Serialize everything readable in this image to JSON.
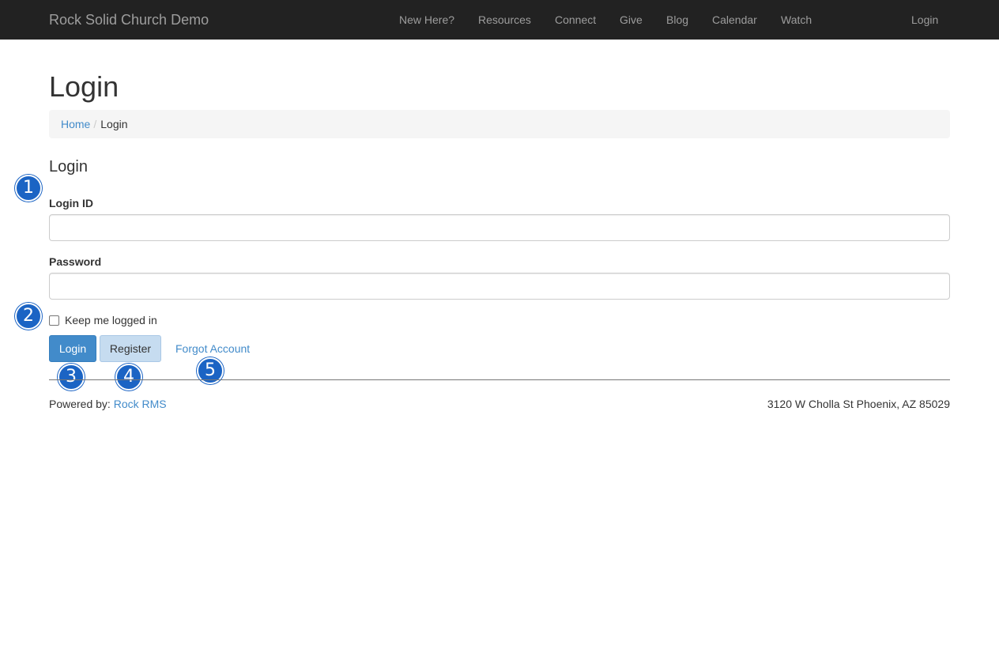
{
  "navbar": {
    "brand": "Rock Solid Church Demo",
    "items": [
      "New Here?",
      "Resources",
      "Connect",
      "Give",
      "Blog",
      "Calendar",
      "Watch"
    ],
    "login": "Login",
    "background": "#222222"
  },
  "page": {
    "title": "Login"
  },
  "breadcrumb": {
    "home": "Home",
    "separator": "/",
    "current": "Login"
  },
  "form": {
    "heading": "Login",
    "login_id_label": "Login ID",
    "login_id_value": "",
    "password_label": "Password",
    "password_value": "",
    "keep_logged_in_label": "Keep me logged in",
    "keep_logged_in_checked": false,
    "login_button": "Login",
    "register_button": "Register",
    "forgot_link": "Forgot Account"
  },
  "callouts": [
    "1",
    "2",
    "3",
    "4",
    "5"
  ],
  "footer": {
    "powered_by_label": "Powered by:",
    "powered_by_link": "Rock RMS",
    "address": "3120 W Cholla St Phoenix, AZ 85029"
  },
  "colors": {
    "accent": "#428bca",
    "callout": "#1b64c4"
  }
}
